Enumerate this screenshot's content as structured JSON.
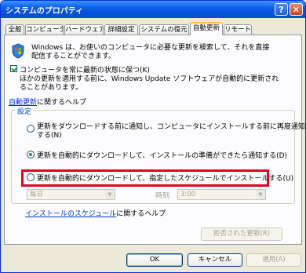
{
  "window": {
    "title": "システムのプロパティ",
    "help": "?",
    "close": "✕"
  },
  "tabs": [
    "全般",
    "コンピュータ名",
    "ハードウェア",
    "詳細設定",
    "システムの復元",
    "自動更新",
    "リモート"
  ],
  "intro": {
    "line1": "Windows は、お使いのコンピュータに必要な更新を検索して、それを直接",
    "line2": "配信することができます。"
  },
  "keep_updated": {
    "label": "コンピュータを常に最新の状態に保つ(K)",
    "desc1": "ほかの更新を適用する前に、Windows Update ソフトウェアが自動的に更新され",
    "desc2": "ることがあります。"
  },
  "help_link": {
    "link": "自動更新",
    "rest": "に関するヘルプ"
  },
  "settings": {
    "legend": "設定",
    "opt1_line1": "更新をダウンロードする前に通知し、コンピュータにインストールする前に再度通知",
    "opt1_line2": "する(N)",
    "opt2": "更新を自動的にダウンロードして、インストールの準備ができたら通知する(D)",
    "opt3": "更新を自動的にダウンロードして、指定したスケジュールでインストールする(U)"
  },
  "schedule": {
    "day": "毎日",
    "time_label": "時刻",
    "time": "3:00"
  },
  "schedule_help": {
    "link": "インストールのスケジュール",
    "rest": "に関するヘルプ"
  },
  "declined_button": "拒否された更新(R)",
  "buttons": {
    "ok": "OK",
    "cancel": "キャンセル",
    "apply": "適用(A)"
  },
  "colors": {
    "highlight": "#e8001c",
    "active_tab": "#ffc83c",
    "title_bar": "#0a5fe8"
  }
}
